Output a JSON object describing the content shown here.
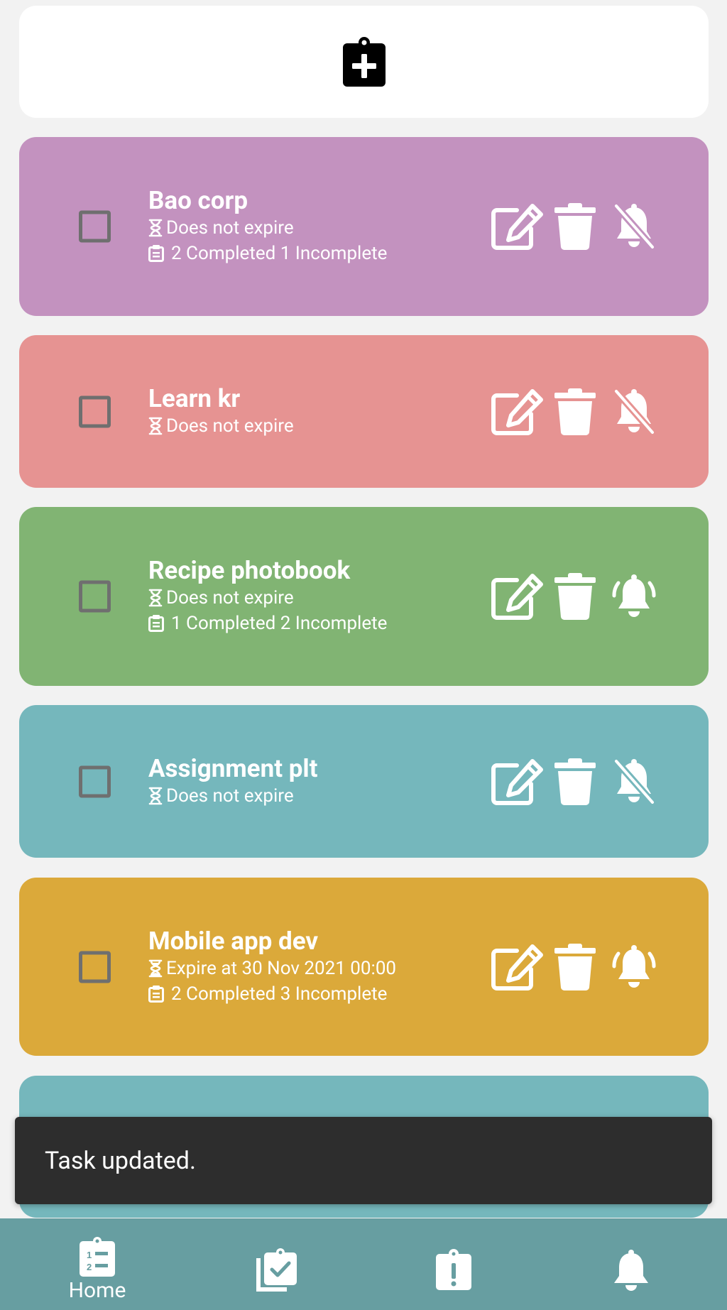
{
  "add_task": {
    "icon": "clipboard-plus-icon"
  },
  "tasks": [
    {
      "title": "Bao corp",
      "expiry": "Does not expire",
      "progress": "2 Completed 1 Incomplete",
      "color": "#c392bf",
      "notifications": "off",
      "checked": false
    },
    {
      "title": "Learn kr",
      "expiry": "Does not expire",
      "color": "#e69392",
      "notifications": "off",
      "checked": false
    },
    {
      "title": "Recipe photobook",
      "expiry": "Does not expire",
      "progress": "1 Completed 2 Incomplete",
      "color": "#81b473",
      "notifications": "on",
      "checked": false
    },
    {
      "title": "Assignment plt",
      "expiry": "Does not expire",
      "color": "#75b7bc",
      "notifications": "off",
      "checked": false
    },
    {
      "title": "Mobile app dev",
      "expiry": "Expire at 30 Nov 2021 00:00",
      "progress": "2 Completed 3 Incomplete",
      "color": "#dba93a",
      "notifications": "on",
      "checked": false
    },
    {
      "color": "#75b7bc"
    }
  ],
  "snackbar": {
    "message": "Task updated."
  },
  "bottom_nav": {
    "items": [
      {
        "label": "Home",
        "icon": "clipboard-list-icon",
        "active": true
      },
      {
        "icon": "clipboard-check-icon"
      },
      {
        "icon": "clipboard-exclamation-icon"
      },
      {
        "icon": "bell-icon"
      }
    ]
  },
  "colors": {
    "background": "#f2f2f2",
    "nav": "#679ea1",
    "snackbar": "#2d2d2d",
    "checkbox": "#6f6f6f"
  }
}
